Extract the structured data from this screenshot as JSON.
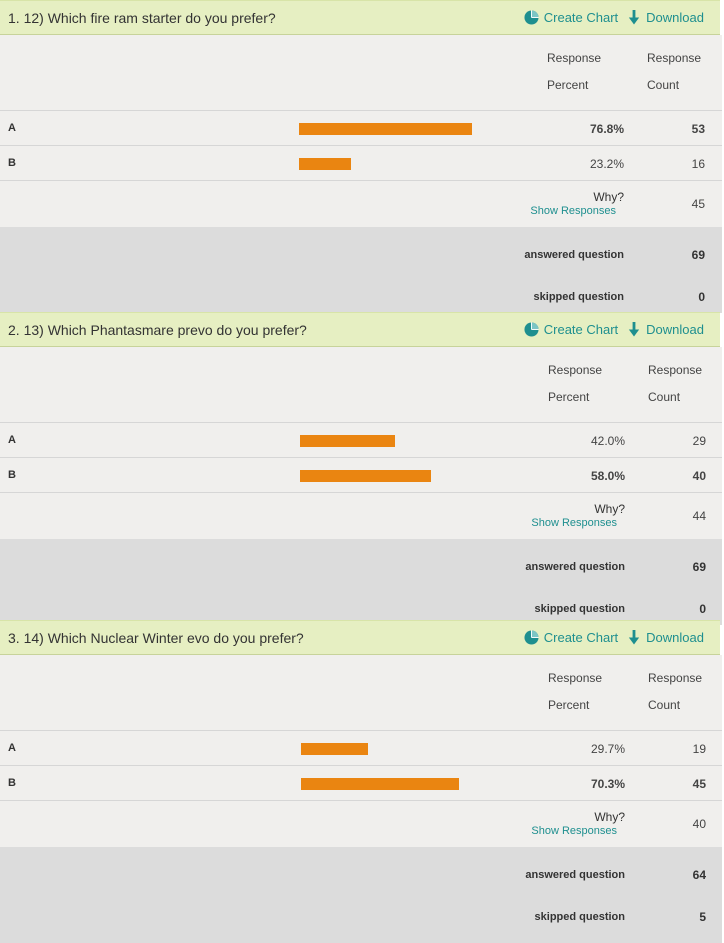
{
  "header_labels": {
    "create_chart": "Create Chart",
    "download": "Download",
    "response": "Response",
    "percent": "Percent",
    "count": "Count",
    "why": "Why?",
    "show_responses": "Show Responses",
    "answered": "answered question",
    "skipped": "skipped question"
  },
  "colors": {
    "accent": "#1e8f8f",
    "bar": "#ea8511",
    "header_bg": "#e6efc2"
  },
  "questions": [
    {
      "title": "1. 12) Which fire ram starter do you prefer?",
      "options": [
        {
          "label": "A",
          "percent_text": "76.8%",
          "percent": 76.8,
          "count": "53",
          "leading": true
        },
        {
          "label": "B",
          "percent_text": "23.2%",
          "percent": 23.2,
          "count": "16",
          "leading": false
        }
      ],
      "why_count": "45",
      "answered": "69",
      "skipped": "0"
    },
    {
      "title": "2. 13) Which Phantasmare prevo do you prefer?",
      "options": [
        {
          "label": "A",
          "percent_text": "42.0%",
          "percent": 42.0,
          "count": "29",
          "leading": false
        },
        {
          "label": "B",
          "percent_text": "58.0%",
          "percent": 58.0,
          "count": "40",
          "leading": true
        }
      ],
      "why_count": "44",
      "answered": "69",
      "skipped": "0"
    },
    {
      "title": "3. 14) Which Nuclear Winter evo do you prefer?",
      "options": [
        {
          "label": "A",
          "percent_text": "29.7%",
          "percent": 29.7,
          "count": "19",
          "leading": false
        },
        {
          "label": "B",
          "percent_text": "70.3%",
          "percent": 70.3,
          "count": "45",
          "leading": true
        }
      ],
      "why_count": "40",
      "answered": "64",
      "skipped": "5"
    }
  ]
}
